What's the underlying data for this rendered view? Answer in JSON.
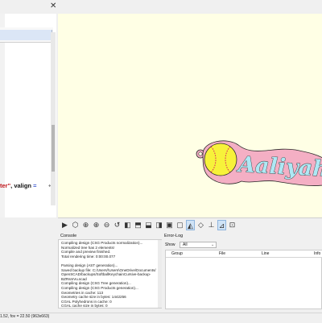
{
  "editor": {
    "code_string": "ter\"",
    "code_keyword": ", valign",
    "code_operator": " ="
  },
  "panes": {
    "console_title": "Console",
    "console_lines": [
      "Compiling design (CSG Products normalization)...",
      "Normalized tree has 2 elements!",
      "Compile and preview finished.",
      "Total rendering time: 0:00:00.077",
      "",
      "Parsing design (AST generation)...",
      "Saved backup file: C:/Users/\\Users\\OneDrive/Documents/",
      "OpenSCAD/backups/SoftballKeychainCursive-backup-",
      "BZRsmVu.scad",
      "Compiling design (CSG Tree generation)...",
      "Compiling design (CSG Products generation)...",
      "Geometries in cache: 113",
      "Geometry cache size in bytes: 1442256",
      "CGAL Polyhedrons in cache: 0",
      "CGAL cache size in bytes: 0",
      "Compiling design (CSG Products normalization)...",
      "Normalized tree has 2 elements!",
      "Compile and preview finished."
    ],
    "errorlog_title": "Error-Log",
    "show_label": "Show",
    "show_value": "All",
    "columns": [
      "Group",
      "File",
      "Line",
      "Info"
    ]
  },
  "model": {
    "text": "Aaliyah",
    "ball_color": "#f7f23a",
    "base_color": "#f4afc4",
    "text_color": "#aee8f4",
    "outline_color": "#2a2a2a",
    "stitch_color": "#d8255a"
  },
  "status": {
    "text": "1.52, fov = 22.50 (963x663)"
  },
  "toolbar": {
    "icons": [
      "preview-icon",
      "render-icon",
      "view-all-icon",
      "zoom-in-icon",
      "zoom-out-icon",
      "reset-view-icon",
      "view-right-icon",
      "view-top-icon",
      "view-bottom-icon",
      "view-left-icon",
      "view-front-icon",
      "view-back-icon",
      "perspective-icon",
      "orthogonal-icon",
      "show-axes-icon",
      "show-scale-icon",
      "show-edges-icon"
    ]
  }
}
